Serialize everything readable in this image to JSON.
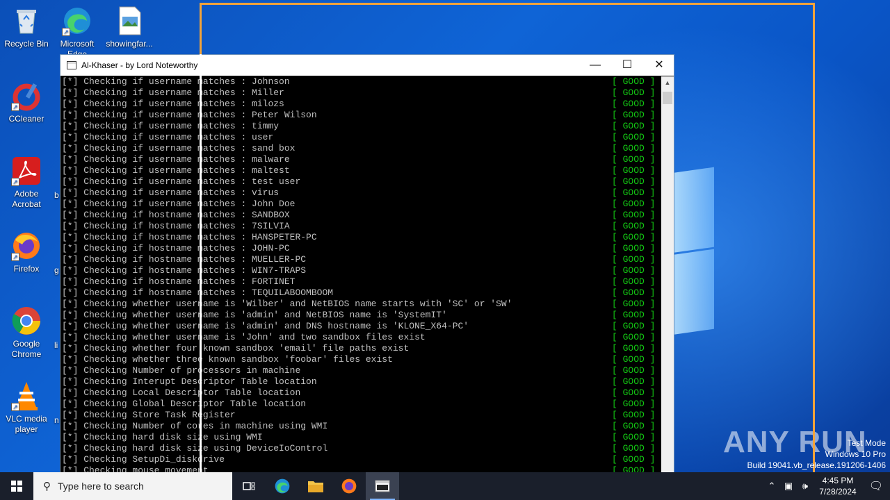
{
  "desktop": {
    "icons": [
      {
        "label": "Recycle Bin",
        "icon": "recycle-bin-icon"
      },
      {
        "label": "Microsoft Edge",
        "icon": "edge-icon"
      },
      {
        "label": "showingfar...",
        "icon": "image-file-icon"
      },
      {
        "label": "CCleaner",
        "icon": "ccleaner-icon"
      },
      {
        "label": "Adobe Acrobat",
        "icon": "acrobat-icon"
      },
      {
        "label": "Firefox",
        "icon": "firefox-icon"
      },
      {
        "label": "Google Chrome",
        "icon": "chrome-icon"
      },
      {
        "label": "VLC media player",
        "icon": "vlc-icon"
      }
    ],
    "partial_labels": [
      "b",
      "g",
      "li",
      "n"
    ]
  },
  "window": {
    "title": "Al-Khaser - by Lord Noteworthy",
    "minimize": "—",
    "maximize": "☐",
    "close": "✕"
  },
  "console": {
    "status_label": "[ GOOD ]",
    "status_color": "#13c713",
    "lines": [
      "[*] Checking if username matches : Johnson",
      "[*] Checking if username matches : Miller",
      "[*] Checking if username matches : milozs",
      "[*] Checking if username matches : Peter Wilson",
      "[*] Checking if username matches : timmy",
      "[*] Checking if username matches : user",
      "[*] Checking if username matches : sand box",
      "[*] Checking if username matches : malware",
      "[*] Checking if username matches : maltest",
      "[*] Checking if username matches : test user",
      "[*] Checking if username matches : virus",
      "[*] Checking if username matches : John Doe",
      "[*] Checking if hostname matches : SANDBOX",
      "[*] Checking if hostname matches : 7SILVIA",
      "[*] Checking if hostname matches : HANSPETER-PC",
      "[*] Checking if hostname matches : JOHN-PC",
      "[*] Checking if hostname matches : MUELLER-PC",
      "[*] Checking if hostname matches : WIN7-TRAPS",
      "[*] Checking if hostname matches : FORTINET",
      "[*] Checking if hostname matches : TEQUILABOOMBOOM",
      "[*] Checking whether username is 'Wilber' and NetBIOS name starts with 'SC' or 'SW'",
      "[*] Checking whether username is 'admin' and NetBIOS name is 'SystemIT'",
      "[*] Checking whether username is 'admin' and DNS hostname is 'KLONE_X64-PC'",
      "[*] Checking whether username is 'John' and two sandbox files exist",
      "[*] Checking whether four known sandbox 'email' file paths exist",
      "[*] Checking whether three known sandbox 'foobar' files exist",
      "[*] Checking Number of processors in machine",
      "[*] Checking Interupt Descriptor Table location",
      "[*] Checking Local Descriptor Table location",
      "[*] Checking Global Descriptor Table location",
      "[*] Checking Store Task Register",
      "[*] Checking Number of cores in machine using WMI",
      "[*] Checking hard disk size using WMI",
      "[*] Checking hard disk size using DeviceIoControl",
      "[*] Checking SetupDi_diskdrive",
      "[*] Checking mouse movement"
    ]
  },
  "watermark": {
    "brand": "ANY RUN",
    "line1": "Test Mode",
    "line2": "Windows 10 Pro",
    "line3": "Build 19041.vb_release.191206-1406"
  },
  "taskbar": {
    "search_placeholder": "Type here to search",
    "apps": [
      "task-view-icon",
      "edge-icon",
      "file-explorer-icon",
      "firefox-icon",
      "console-app-icon"
    ],
    "time": "4:45 PM",
    "date": "7/28/2024"
  }
}
